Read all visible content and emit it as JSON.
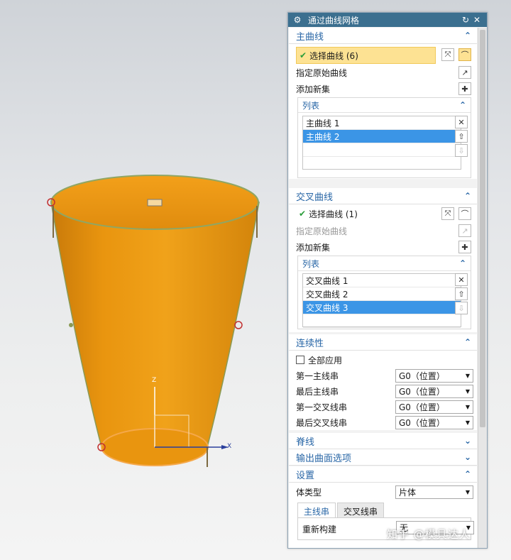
{
  "viewport": {
    "axis_z": "Z",
    "axis_x": "X"
  },
  "dialog": {
    "title": "通过曲线网格",
    "primary": {
      "title": "主曲线",
      "select_label": "选择曲线 (6)",
      "specify_origin": "指定原始曲线",
      "add_set": "添加新集",
      "list_title": "列表",
      "items": [
        "主曲线 1",
        "主曲线 2"
      ]
    },
    "cross": {
      "title": "交叉曲线",
      "select_label": "选择曲线 (1)",
      "specify_origin": "指定原始曲线",
      "add_set": "添加新集",
      "list_title": "列表",
      "items": [
        "交叉曲线 1",
        "交叉曲线 2",
        "交叉曲线 3"
      ]
    },
    "continuity": {
      "title": "连续性",
      "apply_all": "全部应用",
      "rows": [
        {
          "label": "第一主线串",
          "value": "G0（位置）"
        },
        {
          "label": "最后主线串",
          "value": "G0（位置）"
        },
        {
          "label": "第一交叉线串",
          "value": "G0（位置）"
        },
        {
          "label": "最后交叉线串",
          "value": "G0（位置）"
        }
      ]
    },
    "spine": {
      "title": "脊线"
    },
    "output": {
      "title": "输出曲面选项"
    },
    "settings": {
      "title": "设置",
      "body_type_label": "体类型",
      "body_type_value": "片体",
      "tabs": [
        "主线串",
        "交叉线串"
      ],
      "rebuild_label": "重新构建",
      "rebuild_value": "无"
    }
  },
  "watermark": "知乎 @模具达人"
}
